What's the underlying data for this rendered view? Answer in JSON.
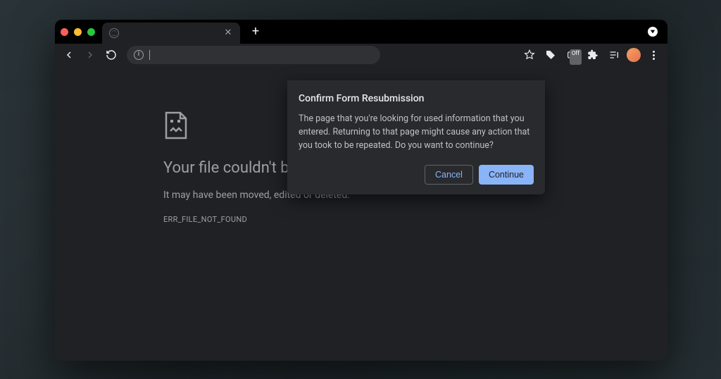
{
  "tabbar": {
    "tab_title": "",
    "close_glyph": "✕",
    "new_tab_glyph": "+"
  },
  "toolbar": {
    "omnibox_value": "",
    "ext_badge": "Off"
  },
  "error": {
    "heading": "Your file couldn't be accessed",
    "subtext": "It may have been moved, edited or deleted.",
    "code": "ERR_FILE_NOT_FOUND"
  },
  "dialog": {
    "title": "Confirm Form Resubmission",
    "body": "The page that you're looking for used information that you entered. Returning to that page might cause any action that you took to be repeated. Do you want to continue?",
    "cancel_label": "Cancel",
    "continue_label": "Continue"
  }
}
